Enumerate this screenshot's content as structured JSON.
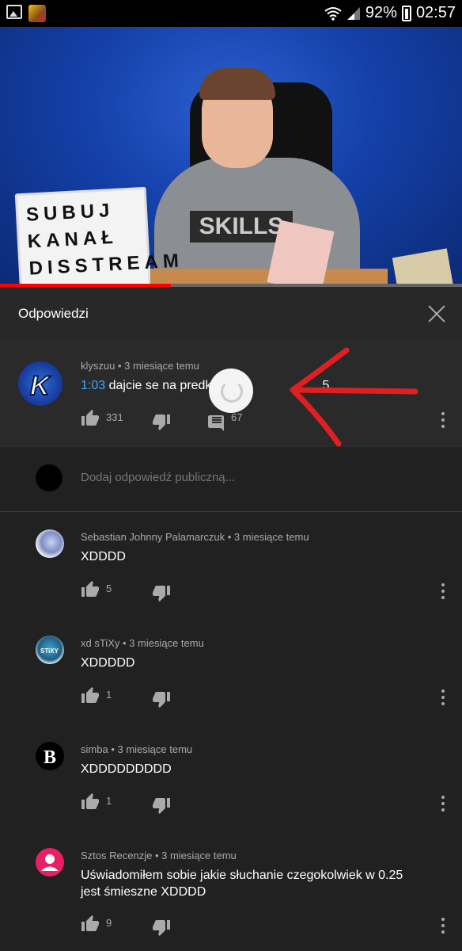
{
  "status_bar": {
    "battery": "92%",
    "time": "02:57"
  },
  "video": {
    "sign_lines": [
      "SUBUJ",
      "KANAŁ",
      "DISSTREAM"
    ],
    "shirt_text": "SKILLS",
    "progress": 0.37
  },
  "replies_panel": {
    "title": "Odpowiedzi"
  },
  "main_comment": {
    "author": "klyszuu",
    "time": "3 miesiące temu",
    "timestamp_link": "1:03",
    "text_visible": "dajcie se na predk",
    "text_tail": "5",
    "likes": "331",
    "replies": "67"
  },
  "add_reply": {
    "placeholder": "Dodaj odpowiedź publiczną..."
  },
  "replies": [
    {
      "author": "Sebastian Johnny Palamarczuk",
      "time": "3 miesiące temu",
      "text": "XDDDD",
      "likes": "5"
    },
    {
      "author": "xd sTiXy",
      "time": "3 miesiące temu",
      "text": "XDDDDD",
      "likes": "1"
    },
    {
      "author": "simba",
      "time": "3 miesiące temu",
      "text": "XDDDDDDDDD",
      "likes": "1"
    },
    {
      "author": "Sztos Recenzje",
      "time": "3 miesiące temu",
      "text_line1": "Uświadomiłem sobie jakie słuchanie czegokolwiek w 0.25",
      "text_line2": "jest śmieszne XDDDD",
      "likes": "9"
    }
  ],
  "colors": {
    "background": "#212121",
    "link": "#3ea6ff",
    "progress": "#ff0000",
    "annotation": "#e02020"
  }
}
